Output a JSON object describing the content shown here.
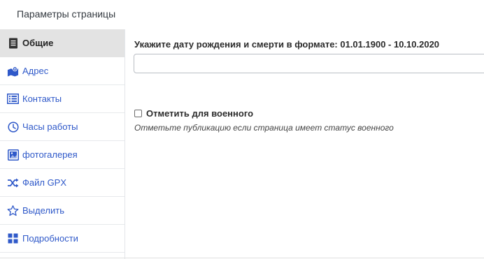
{
  "header": {
    "title": "Параметры страницы"
  },
  "sidebar": {
    "items": [
      {
        "label": "Общие",
        "icon": "document-icon",
        "active": true
      },
      {
        "label": "Адрес",
        "icon": "map-icon",
        "active": false
      },
      {
        "label": "Контакты",
        "icon": "list-icon",
        "active": false
      },
      {
        "label": "Часы работы",
        "icon": "clock-icon",
        "active": false
      },
      {
        "label": "фотогалерея",
        "icon": "image-icon",
        "active": false
      },
      {
        "label": "Файл GPX",
        "icon": "shuffle-icon",
        "active": false
      },
      {
        "label": "Выделить",
        "icon": "star-icon",
        "active": false
      },
      {
        "label": "Подробности",
        "icon": "grid-icon",
        "active": false
      }
    ]
  },
  "main": {
    "date_field": {
      "label": "Укажите дату рождения и смерти в формате: 01.01.1900 - 10.10.2020",
      "value": "",
      "placeholder": ""
    },
    "military": {
      "label": "Отметить для военного",
      "checked": false,
      "help": "Отметьте публикацию если страница имеет статус военного"
    }
  },
  "colors": {
    "link": "#2f59c9",
    "active_bg": "#e3e3e3"
  }
}
